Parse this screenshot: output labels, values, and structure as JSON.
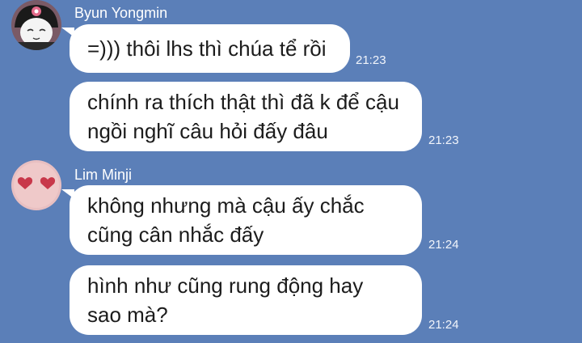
{
  "colors": {
    "background": "#5b7fb8",
    "bubble": "#ffffff",
    "text": "#1c1c1c"
  },
  "groups": [
    {
      "sender": "Byun Yongmin",
      "avatar_icon": "kuromi-avatar-icon",
      "messages": [
        {
          "text": "=))) thôi lhs thì chúa tể rồi",
          "time": "21:23"
        },
        {
          "text": "chính ra thích thật thì đã k để cậu\nngồi nghĩ câu hỏi đấy đâu",
          "time": "21:23"
        }
      ]
    },
    {
      "sender": "Lim Minji",
      "avatar_icon": "heart-eyes-avatar-icon",
      "messages": [
        {
          "text": "không nhưng mà cậu ấy chắc\ncũng cân nhắc đấy",
          "time": "21:24"
        },
        {
          "text": "hình như cũng rung động hay\nsao mà?",
          "time": "21:24"
        }
      ]
    }
  ]
}
